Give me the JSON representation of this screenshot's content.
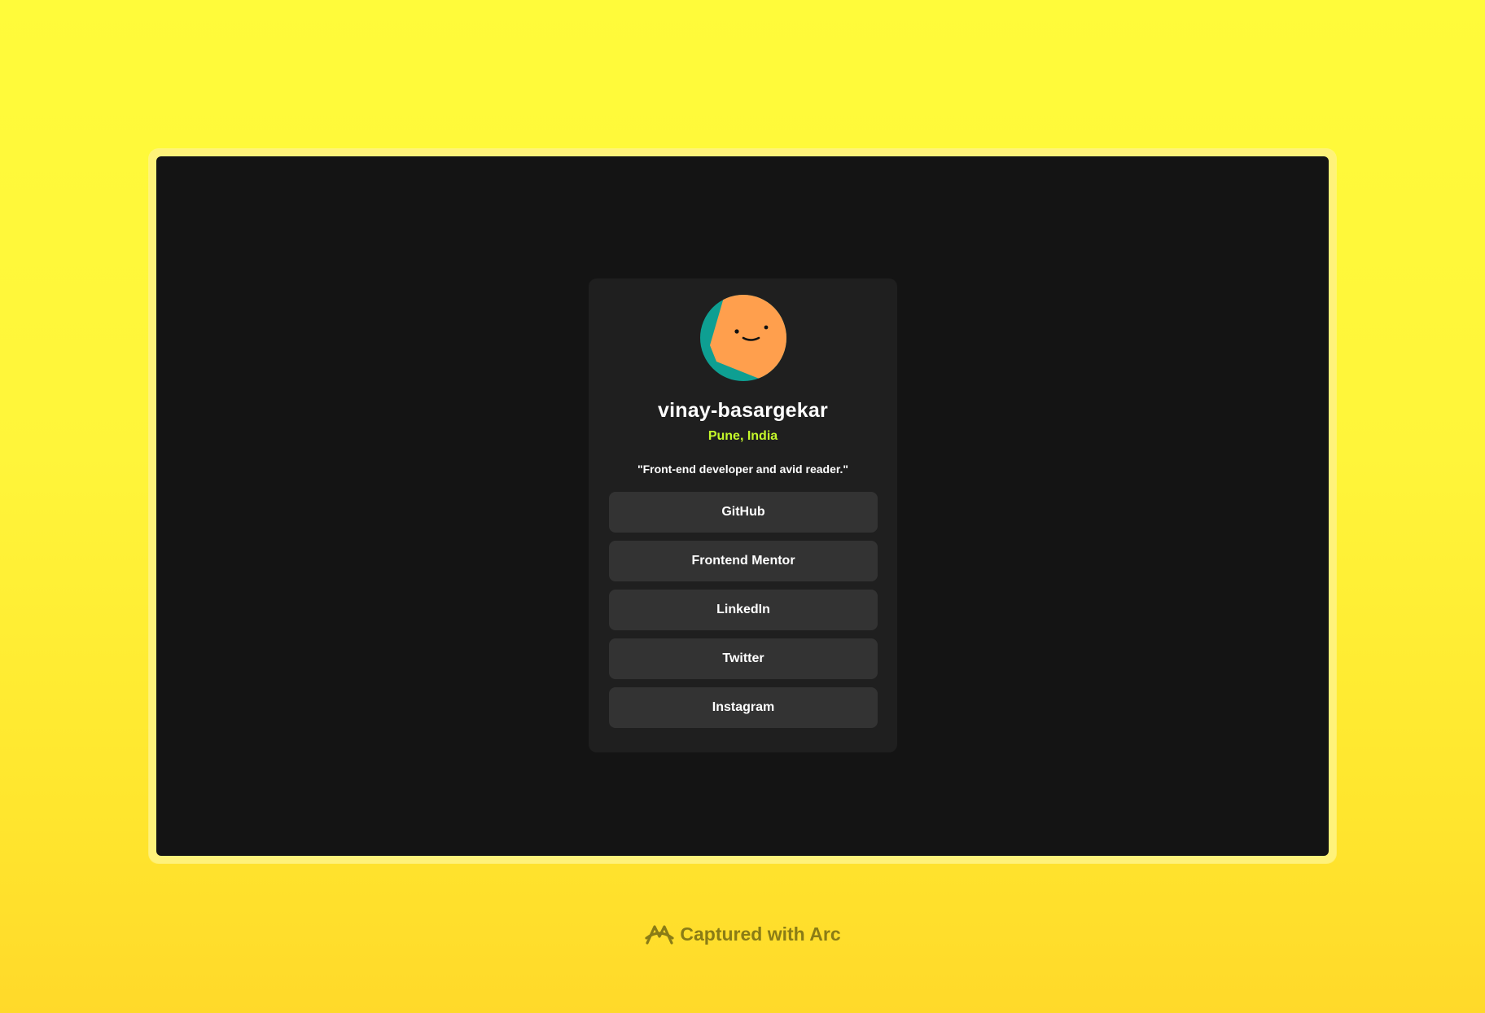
{
  "profile": {
    "avatar_icon": "smiley-avatar-icon",
    "name": "vinay-basargekar",
    "location": "Pune, India",
    "bio": "\"Front-end developer and avid reader.\""
  },
  "links": [
    {
      "label": "GitHub"
    },
    {
      "label": "Frontend Mentor"
    },
    {
      "label": "LinkedIn"
    },
    {
      "label": "Twitter"
    },
    {
      "label": "Instagram"
    }
  ],
  "footer": {
    "icon": "arc-logo-icon",
    "text": "Captured with Arc"
  },
  "colors": {
    "page_background": "#fff53a",
    "frame": "#fff27a",
    "viewport": "#141414",
    "card": "#1f1f1f",
    "button": "#333333",
    "accent_location": "#c4f82a",
    "avatar_teal": "#0e9f92",
    "avatar_orange": "#ff9f4d"
  }
}
